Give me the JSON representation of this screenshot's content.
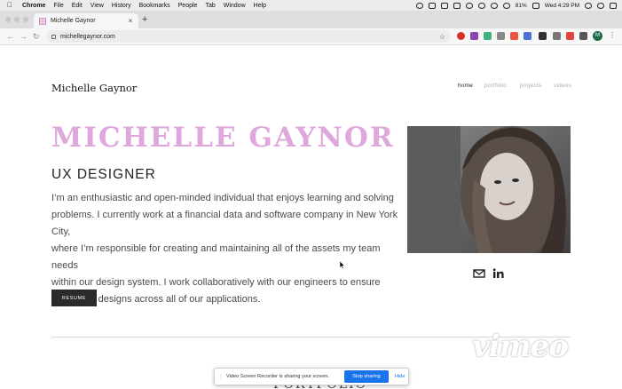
{
  "menubar": {
    "app_name": "Chrome",
    "items": [
      "File",
      "Edit",
      "View",
      "History",
      "Bookmarks",
      "People",
      "Tab",
      "Window",
      "Help"
    ],
    "battery": "81%",
    "clock": "Wed 4:29 PM"
  },
  "browser": {
    "tab_title": "Michelle Gaynor",
    "tab_close": "×",
    "new_tab": "+",
    "url": "michellegaynor.com",
    "profile_initial": "M"
  },
  "site": {
    "logo": "Michelle Gaynor",
    "nav": [
      "home",
      "portfolio",
      "projects",
      "videos"
    ],
    "active_nav": "home",
    "hero_name": "MICHELLE GAYNOR",
    "hero_role": "UX DESIGNER",
    "bio_lines": [
      "I’m an enthusiastic and open-minded individual that enjoys learning and solving",
      "problems. I currently work at a financial data and software company in New York City,",
      "where I’m responsible for creating and maintaining all of the assets my team needs",
      "within our design system. I work collaboratively with our engineers to ensure",
      "consistent designs across all of our applications."
    ],
    "resume_label": "RESUME",
    "portfolio_heading": "PORTFOLIO"
  },
  "overlay": {
    "watermark": "vimeo",
    "share_message": "Video Screen Recorder is sharing your screen.",
    "stop_label": "Stop sharing",
    "hide_label": "Hide"
  },
  "colors": {
    "accent_pink": "#dfa8dc",
    "button_dark": "#2a2a2a",
    "share_blue": "#1a73e8"
  }
}
